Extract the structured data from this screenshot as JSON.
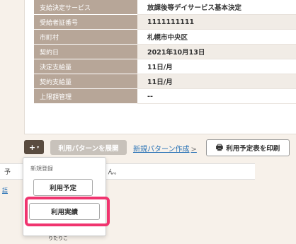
{
  "info_rows": [
    {
      "label": "支給決定サービス",
      "value": "放課後等デイサービス基本決定"
    },
    {
      "label": "受給者証番号",
      "value": "1111111111"
    },
    {
      "label": "市町村",
      "value": "札幌市中央区"
    },
    {
      "label": "契約日",
      "value": "2021年10月13日"
    },
    {
      "label": "決定支給量",
      "value": "11日/月"
    },
    {
      "label": "契約支給量",
      "value": "11日/月"
    },
    {
      "label": "上限額管理",
      "value": "--"
    }
  ],
  "toolbar": {
    "plus_label": "+",
    "caret": "▾",
    "expand_label": "利用パターンを展開",
    "new_pattern_label": "新規パターン作成",
    "new_pattern_chevron": ">",
    "print_label": "利用予定表を印刷"
  },
  "dropdown": {
    "header": "新規登録",
    "items": [
      "利用予定",
      "利用実績"
    ]
  },
  "background": {
    "row_prefix": "予",
    "row_suffix": "ん。",
    "link_text": "語",
    "bottom_text": "りたりこ"
  },
  "colors": {
    "label_bg": "#b7a698",
    "plus_btn_bg": "#5a4c40",
    "highlight": "#f0346f",
    "link": "#2a73b6"
  }
}
